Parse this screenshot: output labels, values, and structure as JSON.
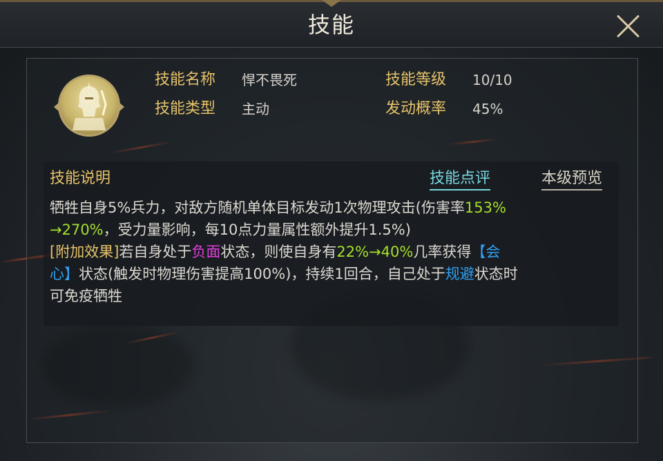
{
  "header": {
    "title": "技能",
    "close_icon": "close-icon"
  },
  "skill": {
    "icon": "spartan-warrior-icon",
    "name_label": "技能名称",
    "name_value": "悍不畏死",
    "level_label": "技能等级",
    "level_value": "10/10",
    "type_label": "技能类型",
    "type_value": "主动",
    "chance_label": "发动概率",
    "chance_value": "45%"
  },
  "description": {
    "title": "技能说明",
    "tab_review": "技能点评",
    "tab_preview": "本级预览",
    "line1_a": "牺牲自身5%兵力，对敌方随机单体目标发动1次物理攻击(伤害率",
    "line1_hl": "153%",
    "line2_hl": "→270%",
    "line2_b": "，受力量影响，每10点力量属性额外提升1.5%)",
    "line3_gold": "[附加效果]",
    "line3_a": "若自身处于",
    "line3_neg": "负面",
    "line3_b": "状态，则使自身有",
    "line3_hl": "22%→40%",
    "line3_c": "几率获得",
    "line3_buff": "【会",
    "line4_buff": "心】",
    "line4_a": "状态(触发时物理伤害提高100%)，持续1回合，自己处于",
    "line4_evade": "规避",
    "line4_b": "状态时",
    "line5": "可免疫牺牲"
  },
  "colors": {
    "gold_label": "#e7c36a",
    "value_up": "#a6e02c",
    "debuff": "#e23ee0",
    "buff": "#2f9ff0",
    "tab_active": "#78d7e0"
  }
}
